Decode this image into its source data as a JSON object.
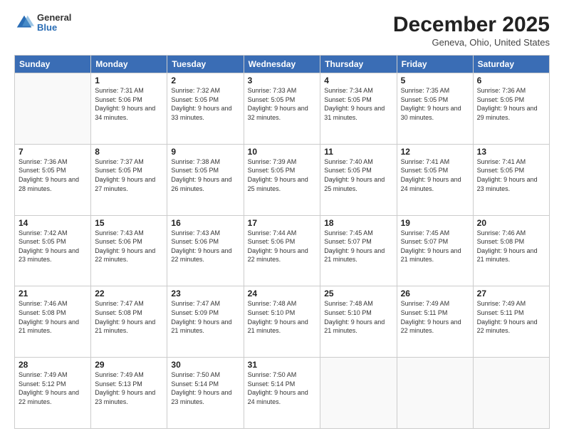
{
  "header": {
    "logo_general": "General",
    "logo_blue": "Blue",
    "month_title": "December 2025",
    "location": "Geneva, Ohio, United States"
  },
  "days_of_week": [
    "Sunday",
    "Monday",
    "Tuesday",
    "Wednesday",
    "Thursday",
    "Friday",
    "Saturday"
  ],
  "weeks": [
    [
      {
        "day": "",
        "sunrise": "",
        "sunset": "",
        "daylight": "",
        "empty": true
      },
      {
        "day": "1",
        "sunrise": "Sunrise: 7:31 AM",
        "sunset": "Sunset: 5:06 PM",
        "daylight": "Daylight: 9 hours and 34 minutes."
      },
      {
        "day": "2",
        "sunrise": "Sunrise: 7:32 AM",
        "sunset": "Sunset: 5:05 PM",
        "daylight": "Daylight: 9 hours and 33 minutes."
      },
      {
        "day": "3",
        "sunrise": "Sunrise: 7:33 AM",
        "sunset": "Sunset: 5:05 PM",
        "daylight": "Daylight: 9 hours and 32 minutes."
      },
      {
        "day": "4",
        "sunrise": "Sunrise: 7:34 AM",
        "sunset": "Sunset: 5:05 PM",
        "daylight": "Daylight: 9 hours and 31 minutes."
      },
      {
        "day": "5",
        "sunrise": "Sunrise: 7:35 AM",
        "sunset": "Sunset: 5:05 PM",
        "daylight": "Daylight: 9 hours and 30 minutes."
      },
      {
        "day": "6",
        "sunrise": "Sunrise: 7:36 AM",
        "sunset": "Sunset: 5:05 PM",
        "daylight": "Daylight: 9 hours and 29 minutes."
      }
    ],
    [
      {
        "day": "7",
        "sunrise": "Sunrise: 7:36 AM",
        "sunset": "Sunset: 5:05 PM",
        "daylight": "Daylight: 9 hours and 28 minutes."
      },
      {
        "day": "8",
        "sunrise": "Sunrise: 7:37 AM",
        "sunset": "Sunset: 5:05 PM",
        "daylight": "Daylight: 9 hours and 27 minutes."
      },
      {
        "day": "9",
        "sunrise": "Sunrise: 7:38 AM",
        "sunset": "Sunset: 5:05 PM",
        "daylight": "Daylight: 9 hours and 26 minutes."
      },
      {
        "day": "10",
        "sunrise": "Sunrise: 7:39 AM",
        "sunset": "Sunset: 5:05 PM",
        "daylight": "Daylight: 9 hours and 25 minutes."
      },
      {
        "day": "11",
        "sunrise": "Sunrise: 7:40 AM",
        "sunset": "Sunset: 5:05 PM",
        "daylight": "Daylight: 9 hours and 25 minutes."
      },
      {
        "day": "12",
        "sunrise": "Sunrise: 7:41 AM",
        "sunset": "Sunset: 5:05 PM",
        "daylight": "Daylight: 9 hours and 24 minutes."
      },
      {
        "day": "13",
        "sunrise": "Sunrise: 7:41 AM",
        "sunset": "Sunset: 5:05 PM",
        "daylight": "Daylight: 9 hours and 23 minutes."
      }
    ],
    [
      {
        "day": "14",
        "sunrise": "Sunrise: 7:42 AM",
        "sunset": "Sunset: 5:05 PM",
        "daylight": "Daylight: 9 hours and 23 minutes."
      },
      {
        "day": "15",
        "sunrise": "Sunrise: 7:43 AM",
        "sunset": "Sunset: 5:06 PM",
        "daylight": "Daylight: 9 hours and 22 minutes."
      },
      {
        "day": "16",
        "sunrise": "Sunrise: 7:43 AM",
        "sunset": "Sunset: 5:06 PM",
        "daylight": "Daylight: 9 hours and 22 minutes."
      },
      {
        "day": "17",
        "sunrise": "Sunrise: 7:44 AM",
        "sunset": "Sunset: 5:06 PM",
        "daylight": "Daylight: 9 hours and 22 minutes."
      },
      {
        "day": "18",
        "sunrise": "Sunrise: 7:45 AM",
        "sunset": "Sunset: 5:07 PM",
        "daylight": "Daylight: 9 hours and 21 minutes."
      },
      {
        "day": "19",
        "sunrise": "Sunrise: 7:45 AM",
        "sunset": "Sunset: 5:07 PM",
        "daylight": "Daylight: 9 hours and 21 minutes."
      },
      {
        "day": "20",
        "sunrise": "Sunrise: 7:46 AM",
        "sunset": "Sunset: 5:08 PM",
        "daylight": "Daylight: 9 hours and 21 minutes."
      }
    ],
    [
      {
        "day": "21",
        "sunrise": "Sunrise: 7:46 AM",
        "sunset": "Sunset: 5:08 PM",
        "daylight": "Daylight: 9 hours and 21 minutes."
      },
      {
        "day": "22",
        "sunrise": "Sunrise: 7:47 AM",
        "sunset": "Sunset: 5:08 PM",
        "daylight": "Daylight: 9 hours and 21 minutes."
      },
      {
        "day": "23",
        "sunrise": "Sunrise: 7:47 AM",
        "sunset": "Sunset: 5:09 PM",
        "daylight": "Daylight: 9 hours and 21 minutes."
      },
      {
        "day": "24",
        "sunrise": "Sunrise: 7:48 AM",
        "sunset": "Sunset: 5:10 PM",
        "daylight": "Daylight: 9 hours and 21 minutes."
      },
      {
        "day": "25",
        "sunrise": "Sunrise: 7:48 AM",
        "sunset": "Sunset: 5:10 PM",
        "daylight": "Daylight: 9 hours and 21 minutes."
      },
      {
        "day": "26",
        "sunrise": "Sunrise: 7:49 AM",
        "sunset": "Sunset: 5:11 PM",
        "daylight": "Daylight: 9 hours and 22 minutes."
      },
      {
        "day": "27",
        "sunrise": "Sunrise: 7:49 AM",
        "sunset": "Sunset: 5:11 PM",
        "daylight": "Daylight: 9 hours and 22 minutes."
      }
    ],
    [
      {
        "day": "28",
        "sunrise": "Sunrise: 7:49 AM",
        "sunset": "Sunset: 5:12 PM",
        "daylight": "Daylight: 9 hours and 22 minutes."
      },
      {
        "day": "29",
        "sunrise": "Sunrise: 7:49 AM",
        "sunset": "Sunset: 5:13 PM",
        "daylight": "Daylight: 9 hours and 23 minutes."
      },
      {
        "day": "30",
        "sunrise": "Sunrise: 7:50 AM",
        "sunset": "Sunset: 5:14 PM",
        "daylight": "Daylight: 9 hours and 23 minutes."
      },
      {
        "day": "31",
        "sunrise": "Sunrise: 7:50 AM",
        "sunset": "Sunset: 5:14 PM",
        "daylight": "Daylight: 9 hours and 24 minutes."
      },
      {
        "day": "",
        "sunrise": "",
        "sunset": "",
        "daylight": "",
        "empty": true
      },
      {
        "day": "",
        "sunrise": "",
        "sunset": "",
        "daylight": "",
        "empty": true
      },
      {
        "day": "",
        "sunrise": "",
        "sunset": "",
        "daylight": "",
        "empty": true
      }
    ]
  ]
}
